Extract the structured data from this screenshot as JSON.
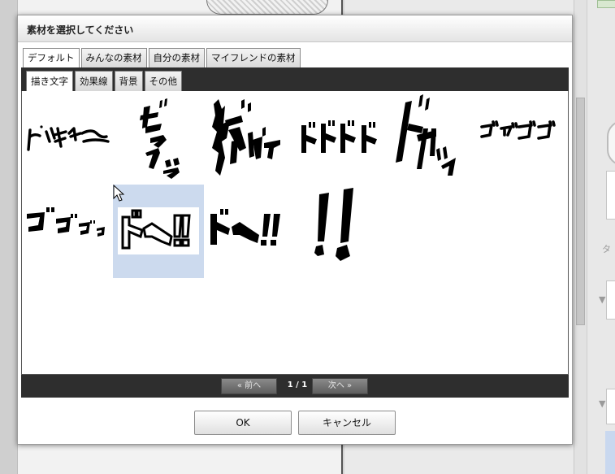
{
  "dialog": {
    "title": "素材を選択してください"
  },
  "source_tabs": [
    {
      "label": "デフォルト",
      "active": true
    },
    {
      "label": "みんなの素材",
      "active": false
    },
    {
      "label": "自分の素材",
      "active": false
    },
    {
      "label": "マイフレンドの素材",
      "active": false
    }
  ],
  "category_tabs": [
    {
      "label": "描き文字",
      "active": true
    },
    {
      "label": "効果線",
      "active": false
    },
    {
      "label": "背景",
      "active": false
    },
    {
      "label": "その他",
      "active": false
    }
  ],
  "materials": [
    {
      "text": "ピッキイーン",
      "selected": false
    },
    {
      "text": "ビクッ",
      "selected": false
    },
    {
      "text": "ドバァ",
      "selected": false
    },
    {
      "text": "ドドドド",
      "selected": false
    },
    {
      "text": "ドサッ",
      "selected": false
    },
    {
      "text": "ゴゴゴゴ",
      "selected": false
    },
    {
      "text": "ゴゴゴゴ",
      "selected": false
    },
    {
      "text": "ドン!!",
      "selected": true
    },
    {
      "text": "ドン!!",
      "selected": false
    },
    {
      "text": "!!",
      "selected": false
    }
  ],
  "pagination": {
    "prev_label": "« 前へ",
    "next_label": "次へ »",
    "info": "1 / 1"
  },
  "buttons": {
    "ok": "OK",
    "cancel": "キャンセル"
  },
  "colors": {
    "selection": "#ccdaee",
    "bar": "#2e2e2e"
  }
}
